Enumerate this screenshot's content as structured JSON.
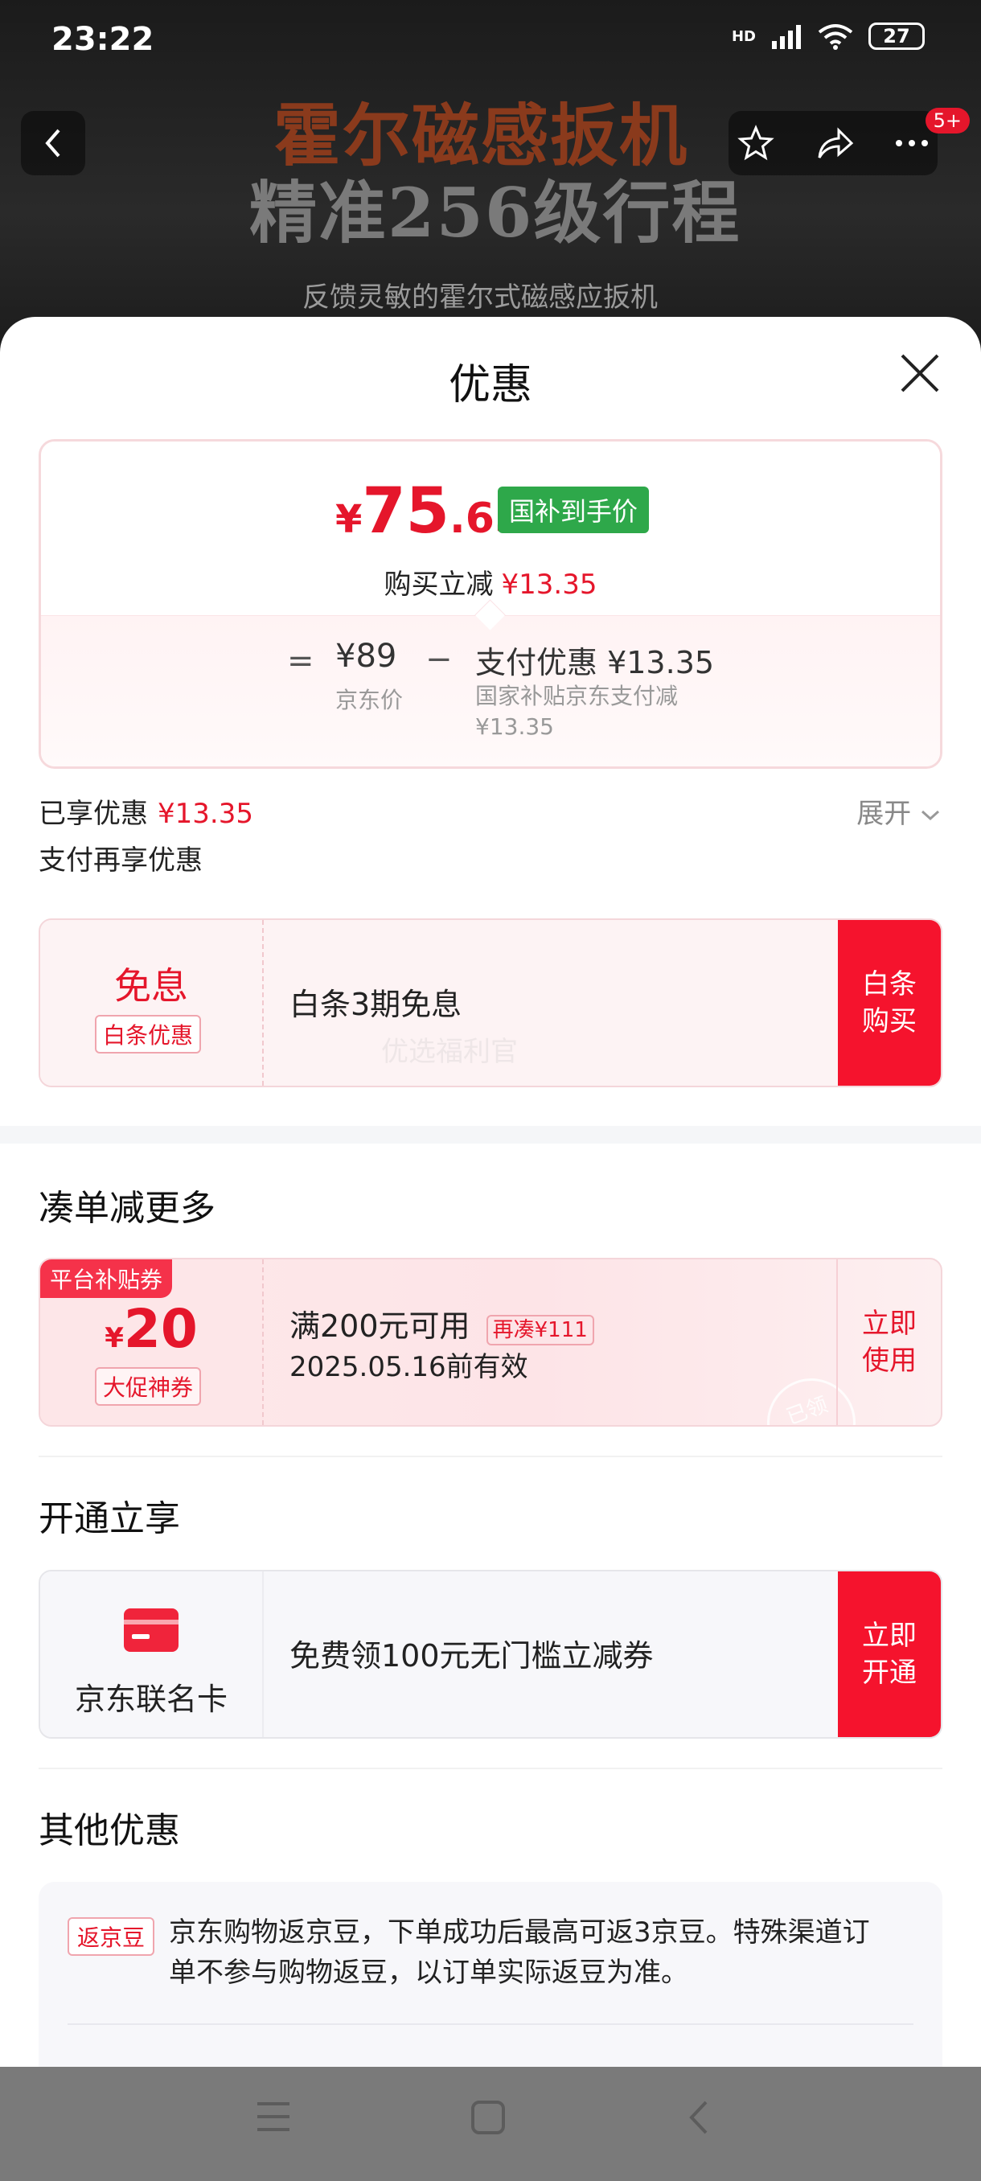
{
  "status_bar": {
    "time": "23:22",
    "battery": "27",
    "hd_label": "HD"
  },
  "background": {
    "headline1": "霍尔磁感扳机",
    "headline2": "精准256级行程",
    "headline3": "反馈灵敏的霍尔式磁感应扳机",
    "cart_badge": "5+"
  },
  "sheet": {
    "title": "优惠",
    "price_card": {
      "currency": "¥",
      "final_int": "75",
      "final_dec": ".65",
      "tag": "国补到手价",
      "reduce_label": "购买立减",
      "reduce_value": "¥13.35",
      "eq": "=",
      "base_price": "¥89",
      "base_label": "京东价",
      "minus": "−",
      "pay_discount": "支付优惠 ¥13.35",
      "pay_sub": "国家补贴京东支付减¥13.35"
    },
    "enjoyed_label": "已享优惠",
    "enjoyed_value": "¥13.35",
    "expand_label": "展开",
    "pay_more_label": "支付再享优惠",
    "baitiao": {
      "title": "免息",
      "tag": "白条优惠",
      "text": "白条3期免息",
      "watermark": "优选福利官",
      "btn_line1": "白条",
      "btn_line2": "购买"
    },
    "section_more": "凑单减更多",
    "coupon": {
      "corner": "平台补贴券",
      "currency": "¥",
      "amount": "20",
      "tag": "大促神券",
      "condition": "满200元可用",
      "extra_tag": "再凑¥111",
      "valid": "2025.05.16前有效",
      "btn_line1": "立即",
      "btn_line2": "使用",
      "stamp": "已领"
    },
    "section_open": "开通立享",
    "jdcard": {
      "name": "京东联名卡",
      "text": "免费领100元无门槛立减券",
      "btn_line1": "立即",
      "btn_line2": "开通"
    },
    "section_other": "其他优惠",
    "fanjingdou": {
      "tag": "返京豆",
      "text": "京东购物返京豆，下单成功后最高可返3京豆。特殊渠道订单不参与购物返豆，以订单实际返豆为准。"
    }
  }
}
